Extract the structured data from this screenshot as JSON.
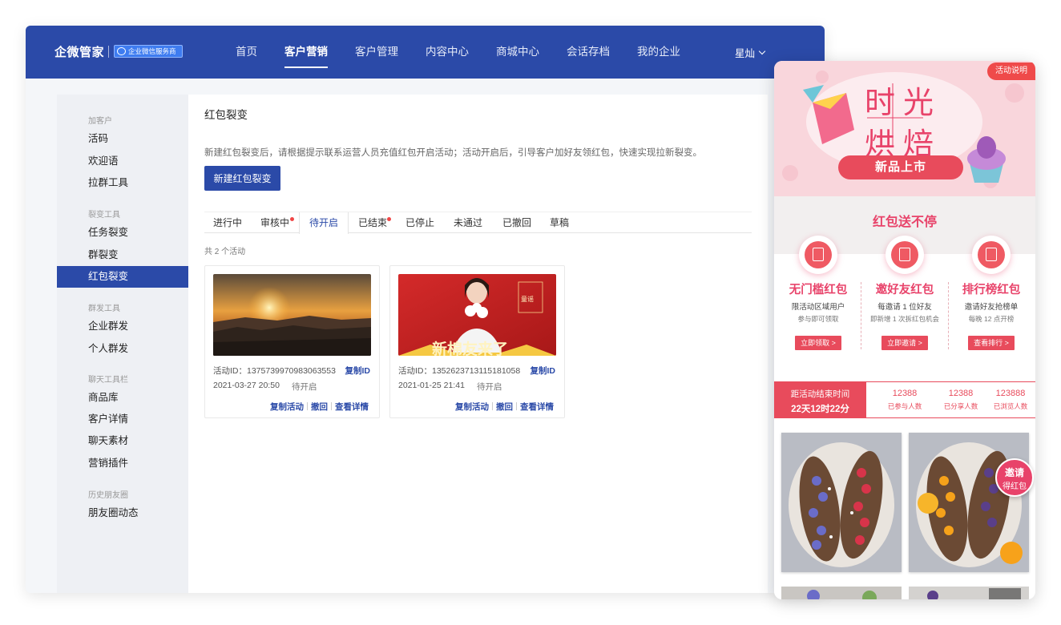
{
  "header": {
    "brand": "企微管家",
    "badge": "企业微信服务商",
    "nav": [
      "首页",
      "客户营销",
      "客户管理",
      "内容中心",
      "商城中心",
      "会话存档",
      "我的企业"
    ],
    "active_nav": "客户营销",
    "user": "星灿"
  },
  "sidebar": {
    "groups": [
      {
        "title": "加客户",
        "items": [
          "活码",
          "欢迎语",
          "拉群工具"
        ]
      },
      {
        "title": "裂变工具",
        "items": [
          "任务裂变",
          "群裂变",
          "红包裂变"
        ]
      },
      {
        "title": "群发工具",
        "items": [
          "企业群发",
          "个人群发"
        ]
      },
      {
        "title": "聊天工具栏",
        "items": [
          "商品库",
          "客户详情",
          "聊天素材",
          "营销插件"
        ]
      },
      {
        "title": "历史朋友圈",
        "items": [
          "朋友圈动态"
        ]
      }
    ],
    "active_item": "红包裂变"
  },
  "main": {
    "title": "红包裂变",
    "description": "新建红包裂变后，请根据提示联系运营人员充值红包开启活动；活动开启后，引导客户加好友领红包，快速实现拉新裂变。",
    "new_button": "新建红包裂变",
    "tabs": [
      "进行中",
      "审核中",
      "待开启",
      "已结束",
      "已停止",
      "未通过",
      "已撤回",
      "草稿"
    ],
    "active_tab": "待开启",
    "count_text": "共 2 个活动",
    "cards": [
      {
        "id_text": "活动ID：1375739970983063553",
        "copy_id": "复制ID",
        "date": "2021-03-27 20:50",
        "status": "待开启",
        "actions": [
          "复制活动",
          "撤回",
          "查看详情"
        ]
      },
      {
        "id_text": "活动ID：1352623713115181058",
        "copy_id": "复制ID",
        "date": "2021-01-25 21:41",
        "status": "待开启",
        "actions": [
          "复制活动",
          "撤回",
          "查看详情"
        ],
        "poster_text": "新棉友来了",
        "poster_name": "童谣"
      }
    ]
  },
  "preview": {
    "rules_tag": "活动说明",
    "banner_line1": "时光",
    "banner_line2": "烘焙",
    "banner_pill": "新品上市",
    "section_title": "红包送不停",
    "columns": [
      {
        "title": "无门槛红包",
        "d1": "限活动区域用户",
        "d2": "参与即可领取",
        "button": "立即领取 >"
      },
      {
        "title": "邀好友红包",
        "d1": "每邀请 1 位好友",
        "d2": "即新增 1 次拆红包机会",
        "button": "立即邀请 >"
      },
      {
        "title": "排行榜红包",
        "d1": "邀请好友抢榜单",
        "d2": "每晚 12 点开榜",
        "button": "查看排行 >"
      }
    ],
    "countdown_label": "距活动结束时间",
    "countdown_value": "22天12时22分",
    "stats": [
      {
        "value": "12388",
        "label": "已参与人数"
      },
      {
        "value": "12388",
        "label": "已分享人数"
      },
      {
        "value": "123888",
        "label": "已浏览人数"
      }
    ],
    "invite_line1": "邀请",
    "invite_line2": "得红包"
  },
  "colors": {
    "brand_blue": "#2b4aa8",
    "accent_red": "#e84b5c",
    "pink": "#e8436a"
  }
}
